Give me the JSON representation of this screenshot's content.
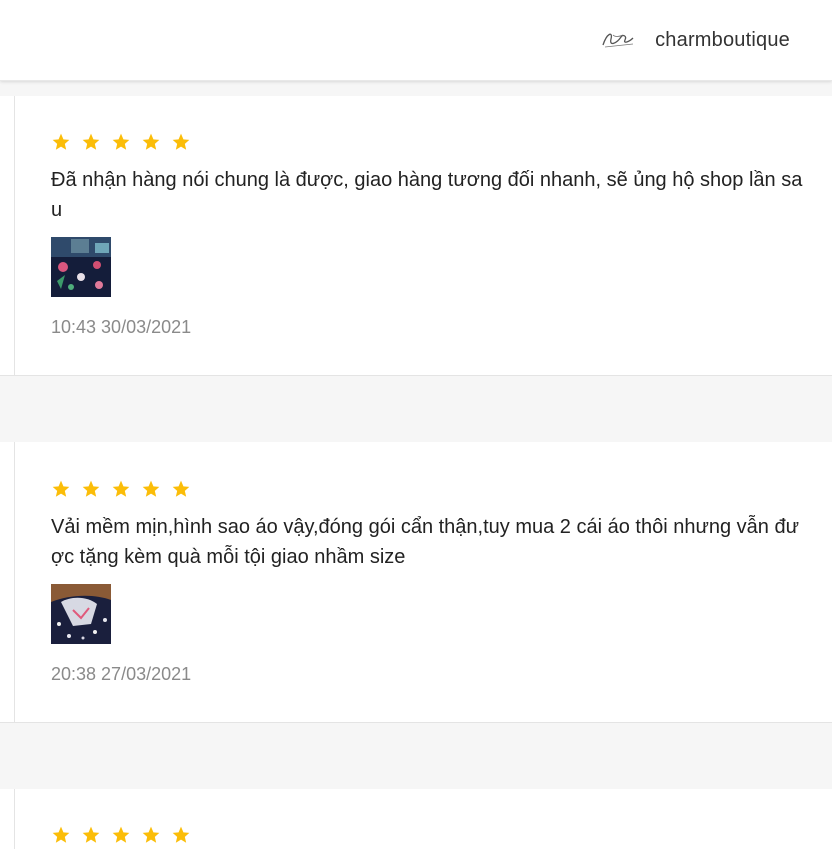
{
  "shop": {
    "name": "charmboutique",
    "logo_icon": "signature-logo-icon"
  },
  "colors": {
    "star": "#fbbd08",
    "text": "#222222",
    "muted": "#8a8a8a",
    "divider": "#e4e4e4",
    "page_bg": "#f6f6f6"
  },
  "reviews": [
    {
      "rating": 5,
      "text": "Đã nhận hàng nói chung là được, giao hàng tương đối nhanh, sẽ ủng hộ shop lần sau",
      "time": "10:43 30/03/2021"
    },
    {
      "rating": 5,
      "text": "Vải mềm mịn,hình sao áo vậy,đóng gói cẩn thận,tuy mua 2 cái áo thôi nhưng vẫn được tặng kèm quà mỗi tội giao nhầm size",
      "time": "20:38 27/03/2021"
    },
    {
      "rating": 5
    }
  ]
}
